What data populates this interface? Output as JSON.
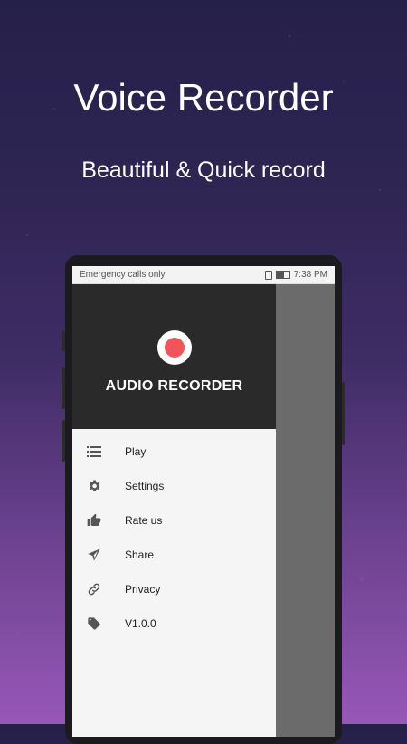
{
  "hero": {
    "title": "Voice Recorder",
    "subtitle": "Beautiful & Quick record"
  },
  "statusbar": {
    "carrier": "Emergency calls only",
    "time": "7:38 PM"
  },
  "drawer": {
    "app_name": "AUDIO RECORDER",
    "record_color": "#f2545b",
    "items": [
      {
        "label": "Play",
        "icon": "list-icon"
      },
      {
        "label": "Settings",
        "icon": "gear-icon"
      },
      {
        "label": "Rate us",
        "icon": "thumbs-up-icon"
      },
      {
        "label": "Share",
        "icon": "send-icon"
      },
      {
        "label": "Privacy",
        "icon": "link-icon"
      },
      {
        "label": "V1.0.0",
        "icon": "tag-icon"
      }
    ]
  },
  "colors": {
    "header_bg": "#2a2a2a",
    "drawer_bg": "#f5f5f5",
    "scrim": "#6b6b6b",
    "icon": "#555555"
  }
}
